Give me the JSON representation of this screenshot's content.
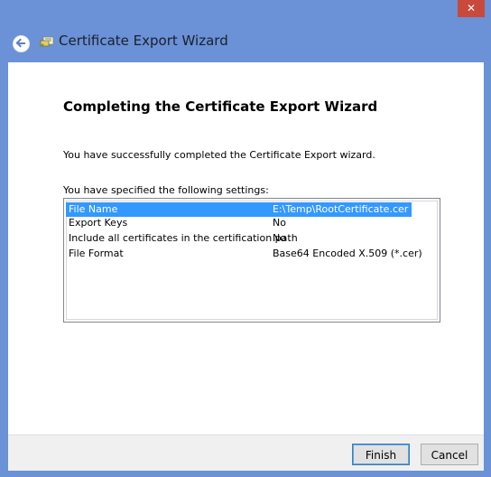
{
  "window": {
    "title": "Certificate Export Wizard",
    "close_glyph": "✕"
  },
  "heading": "Completing the Certificate Export Wizard",
  "description": "You have successfully completed the Certificate Export wizard.",
  "settings": {
    "label": "You have specified the following settings:",
    "rows": [
      {
        "key": "File Name",
        "value": "E:\\Temp\\RootCertificate.cer",
        "selected": true
      },
      {
        "key": "Export Keys",
        "value": "No",
        "selected": false
      },
      {
        "key": "Include all certificates in the certification path",
        "value": "No",
        "selected": false
      },
      {
        "key": "File Format",
        "value": "Base64 Encoded X.509 (*.cer)",
        "selected": false
      }
    ]
  },
  "buttons": {
    "finish": "Finish",
    "cancel": "Cancel"
  },
  "colors": {
    "frame": "#6b91d6",
    "selection": "#3399ff",
    "close": "#c9493c"
  },
  "icons": {
    "back": "back-arrow-icon",
    "wizard": "certificate-wizard-icon",
    "close": "close-icon"
  }
}
